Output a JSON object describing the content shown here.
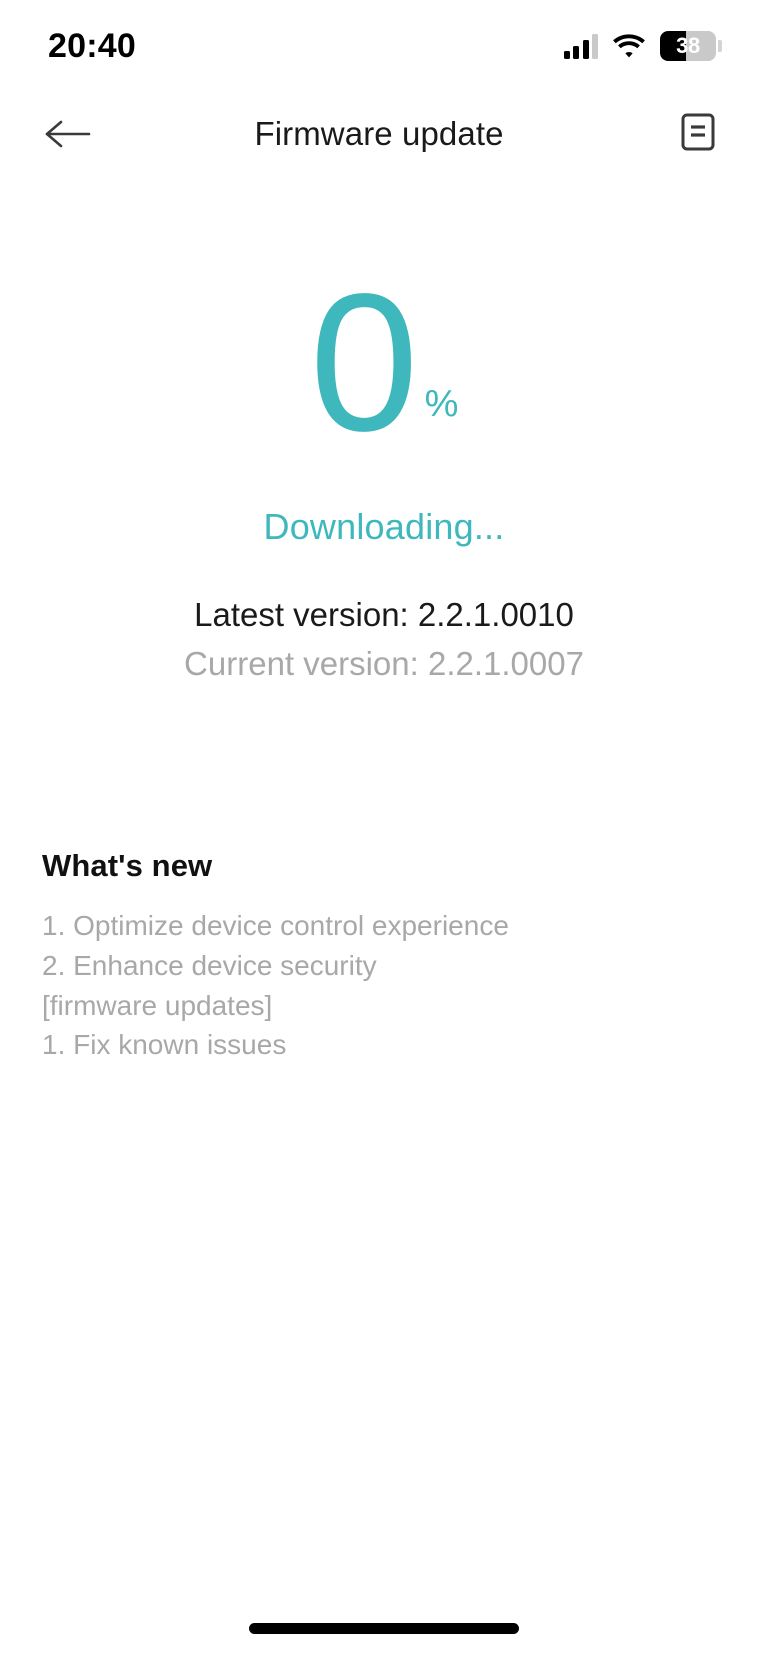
{
  "status_bar": {
    "time": "20:40",
    "battery_percent": "38",
    "signal_icon": "cellular-signal-icon",
    "wifi_icon": "wifi-icon",
    "battery_icon": "battery-icon"
  },
  "app_bar": {
    "back_icon": "back-arrow-icon",
    "title": "Firmware update",
    "menu_icon": "update-log-icon"
  },
  "progress": {
    "percent_value": "0",
    "percent_unit": "%",
    "status_label": "Downloading...",
    "latest_version": "Latest version: 2.2.1.0010",
    "current_version": "Current version: 2.2.1.0007",
    "accent_color": "#3fb8bd",
    "muted_color": "#a8a8a8"
  },
  "whats_new": {
    "title": "What's new",
    "items": [
      "1. Optimize device control experience",
      "2. Enhance device security",
      "[firmware updates]",
      "1. Fix known issues"
    ]
  }
}
